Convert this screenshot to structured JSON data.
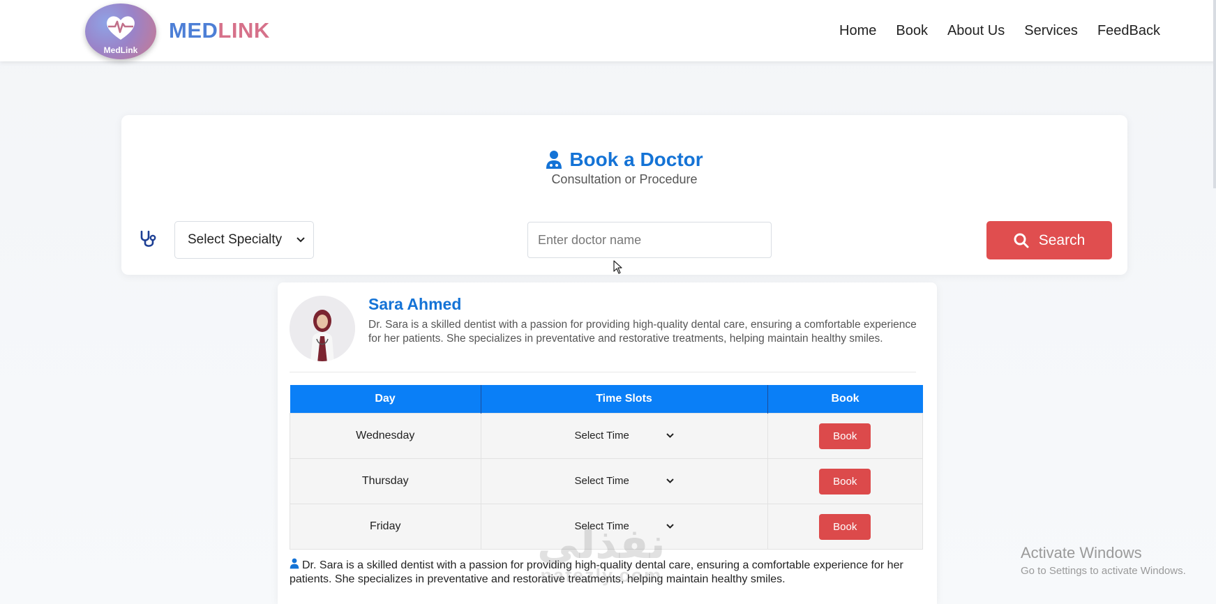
{
  "navbar": {
    "logo_text": "MedLink",
    "brand_part1": "MED",
    "brand_part2": "LINK",
    "links": [
      "Home",
      "Book",
      "About Us",
      "Services",
      "FeedBack"
    ]
  },
  "search_card": {
    "title": "Book a Doctor",
    "subtitle": "Consultation or Procedure",
    "specialty_select": "Select Specialty",
    "doctor_name_placeholder": "Enter doctor name",
    "search_label": "Search"
  },
  "doctor": {
    "name": "Sara Ahmed",
    "bio": "Dr. Sara is a skilled dentist with a passion for providing high-quality dental care, ensuring a comfortable experience for her patients. She specializes in preventative and restorative treatments, helping maintain healthy smiles.",
    "schedule": {
      "headers": [
        "Day",
        "Time Slots",
        "Book"
      ],
      "rows": [
        {
          "day": "Wednesday",
          "time": "Select Time",
          "book": "Book"
        },
        {
          "day": "Thursday",
          "time": "Select Time",
          "book": "Book"
        },
        {
          "day": "Friday",
          "time": "Select Time",
          "book": "Book"
        }
      ]
    },
    "bio_repeat": "Dr. Sara is a skilled dentist with a passion for providing high-quality dental care, ensuring a comfortable experience for her patients. She specializes in preventative and restorative treatments, helping maintain healthy smiles."
  },
  "watermark": {
    "arabic": "نفذلي",
    "latin": "nafezly.com"
  },
  "os_overlay": {
    "line1": "Activate Windows",
    "line2": "Go to Settings to activate Windows."
  },
  "colors": {
    "primary_blue": "#1473d6",
    "table_header": "#0a7ff7",
    "danger_red": "#e04e4f",
    "brand_blue": "#4d7fd6",
    "brand_pink": "#d6718a"
  },
  "icons": {
    "doctor": "doctor-icon",
    "stethoscope": "stethoscope-icon",
    "search": "search-icon",
    "chevron": "chevron-down-icon"
  }
}
